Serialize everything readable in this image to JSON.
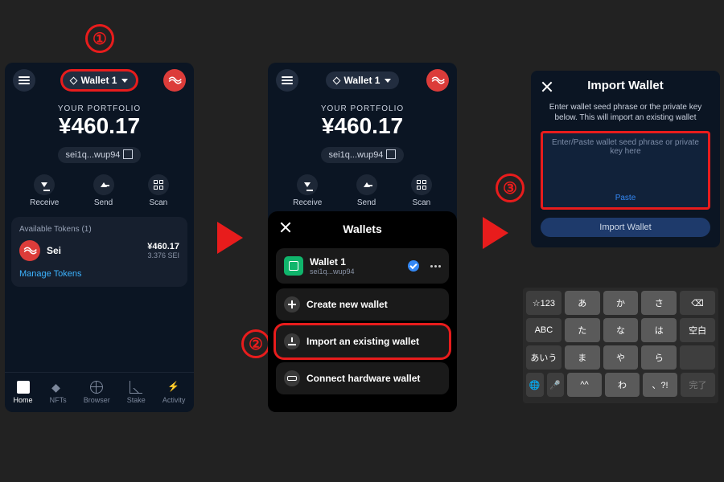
{
  "steps": {
    "s1": "①",
    "s2": "②",
    "s3": "③"
  },
  "wallet_main": {
    "wallet_label": "Wallet 1",
    "portfolio_label": "YOUR PORTFOLIO",
    "portfolio_value": "¥460.17",
    "address_short": "sei1q...wup94",
    "actions": {
      "receive": "Receive",
      "send": "Send",
      "scan": "Scan"
    },
    "tokens_header": "Available Tokens (1)",
    "token": {
      "name": "Sei",
      "value_fiat": "¥460.17",
      "value_native": "3.376 SEI"
    },
    "manage": "Manage Tokens",
    "tabs": {
      "home": "Home",
      "nfts": "NFTs",
      "browser": "Browser",
      "stake": "Stake",
      "activity": "Activity"
    }
  },
  "wallets_sheet": {
    "title": "Wallets",
    "current": {
      "name": "Wallet 1",
      "addr": "sei1q...wup94"
    },
    "create": "Create new wallet",
    "import": "Import an existing wallet",
    "hardware": "Connect hardware wallet"
  },
  "import_page": {
    "title": "Import Wallet",
    "desc": "Enter wallet seed phrase or the private key below. This will import an existing wallet",
    "placeholder": "Enter/Paste wallet seed phrase or private key here",
    "paste": "Paste",
    "button": "Import Wallet"
  },
  "keyboard": {
    "rows": [
      [
        "☆123",
        "あ",
        "か",
        "さ",
        "⌫"
      ],
      [
        "ABC",
        "た",
        "な",
        "は",
        "空白"
      ],
      [
        "あいう",
        "ま",
        "や",
        "ら",
        ""
      ],
      [
        "🌐",
        "🎤",
        "^^",
        "わ",
        "、?!",
        "完了"
      ]
    ]
  }
}
